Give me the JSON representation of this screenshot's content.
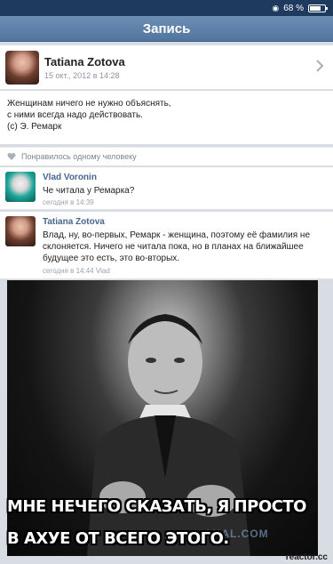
{
  "status": {
    "battery": "68 %"
  },
  "nav": {
    "title": "Запись"
  },
  "post": {
    "author": "Tatiana Zotova",
    "date": "15 окт., 2012 в 14:28",
    "text": "Женщинам ничего не нужно объяснять,\nс ними всегда надо действовать.\n(c) Э. Ремарк",
    "likes": "Понравилось одному человеку"
  },
  "comments": [
    {
      "author": "Vlad Voronin",
      "text": "Че читала у Ремарка?",
      "time": "сегодня в 14:39"
    },
    {
      "author": "Tatiana Zotova",
      "text": "Влад, ну, во-первых, Ремарк - женщина, поэтому её фамилия не склоняется. Ничего не читала пока, но в планах на ближайшее будущее это есть, это во-вторых.",
      "time": "сегодня в 14:44 Vlad"
    }
  ],
  "meme": {
    "line1": "МНЕ НЕЧЕГО СКАЗАТЬ, Я ПРОСТО",
    "line2": "В АХУЕ ОТ ВСЕГО ЭТОГО.",
    "watermark": "AKAL.COM"
  },
  "footer": {
    "site": "reactor.cc"
  },
  "colors": {
    "nav": "#52759f",
    "link": "#45678f",
    "background": "#d8dde3"
  }
}
